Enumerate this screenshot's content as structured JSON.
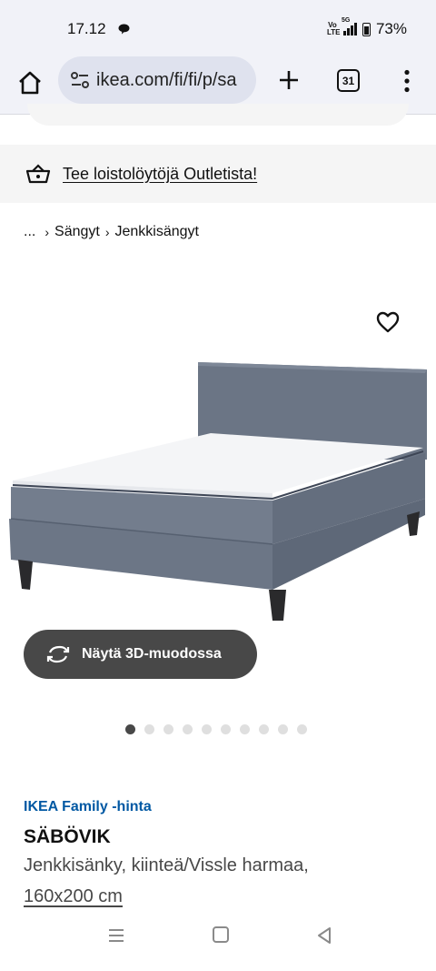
{
  "status_bar": {
    "time": "17.12",
    "network": "5G",
    "volte": "Vo LTE",
    "battery": "73%"
  },
  "browser": {
    "url": "ikea.com/fi/fi/p/sa",
    "tab_count": "31"
  },
  "outlet_banner": {
    "text": "Tee loistolöytöjä Outletista!"
  },
  "breadcrumb": {
    "ellipsis": "...",
    "items": [
      "Sängyt",
      "Jenkkisängyt"
    ]
  },
  "product": {
    "view3d_label": "Näytä 3D-muodossa",
    "image_count": 10,
    "active_image_index": 0,
    "family_price_label": "IKEA Family -hinta",
    "name": "SÄBÖVIK",
    "description": "Jenkkisänky, kiinteä/Vissle harmaa,",
    "size": "160x200 cm"
  },
  "colors": {
    "accent_blue": "#0058a3",
    "button_dark": "#484848",
    "fabric_grey": "#6e7887"
  },
  "icons": {
    "home": "home-icon",
    "site_settings": "tune-icon",
    "new_tab": "plus-icon",
    "tabs": "tabs-icon",
    "menu": "kebab-menu-icon",
    "outlet": "shopping-basket-icon",
    "favourite": "heart-icon",
    "view3d": "rotate-3d-icon"
  }
}
